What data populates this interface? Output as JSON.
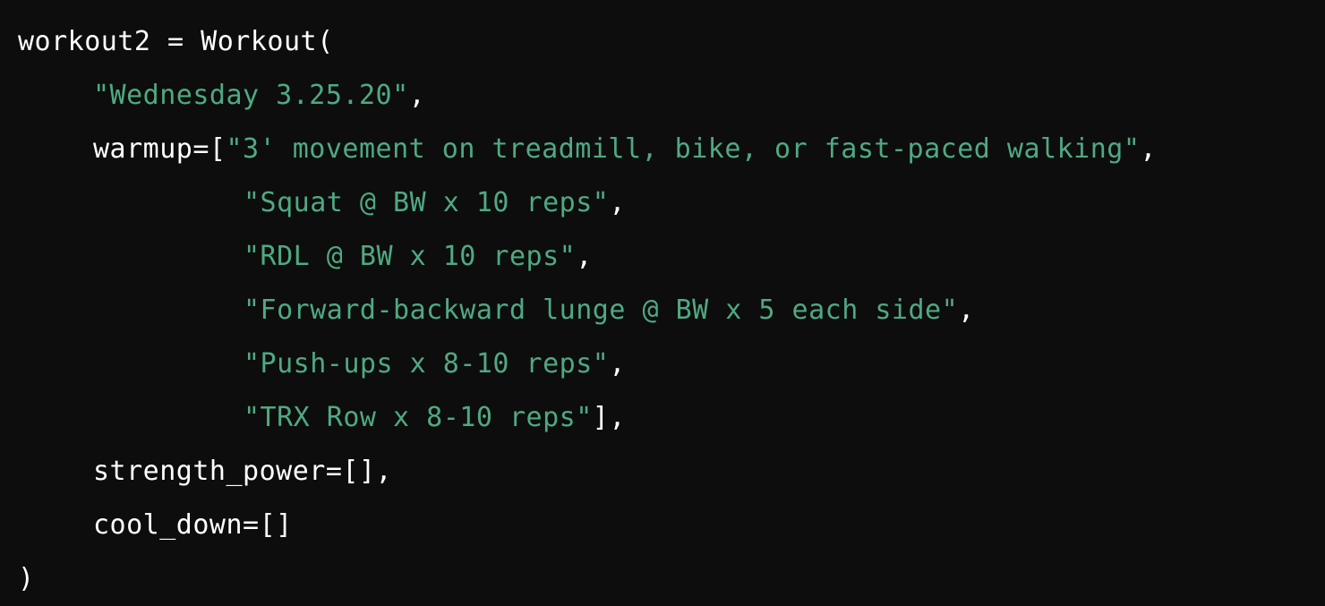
{
  "code": {
    "line1": {
      "text": "workout2 = Workout("
    },
    "line2": {
      "string": "\"Wednesday 3.25.20\"",
      "tail": ","
    },
    "line3": {
      "prefix": "warmup=[",
      "string": "\"3' movement on treadmill, bike, or fast-paced walking\"",
      "tail": ","
    },
    "warmup_items": [
      {
        "string": "\"Squat @ BW x 10 reps\"",
        "tail": ","
      },
      {
        "string": "\"RDL @ BW x 10 reps\"",
        "tail": ","
      },
      {
        "string": "\"Forward-backward lunge @ BW x 5 each side\"",
        "tail": ","
      },
      {
        "string": "\"Push-ups x 8-10 reps\"",
        "tail": ","
      },
      {
        "string": "\"TRX Row x 8-10 reps\"",
        "tail": "],"
      }
    ],
    "line9": {
      "text": "strength_power=[],"
    },
    "line10": {
      "text": "cool_down=[]"
    },
    "line11": {
      "text": ")"
    }
  },
  "colors": {
    "background": "#0d0d0d",
    "plain_text": "#ffffff",
    "string": "#4fa982"
  }
}
